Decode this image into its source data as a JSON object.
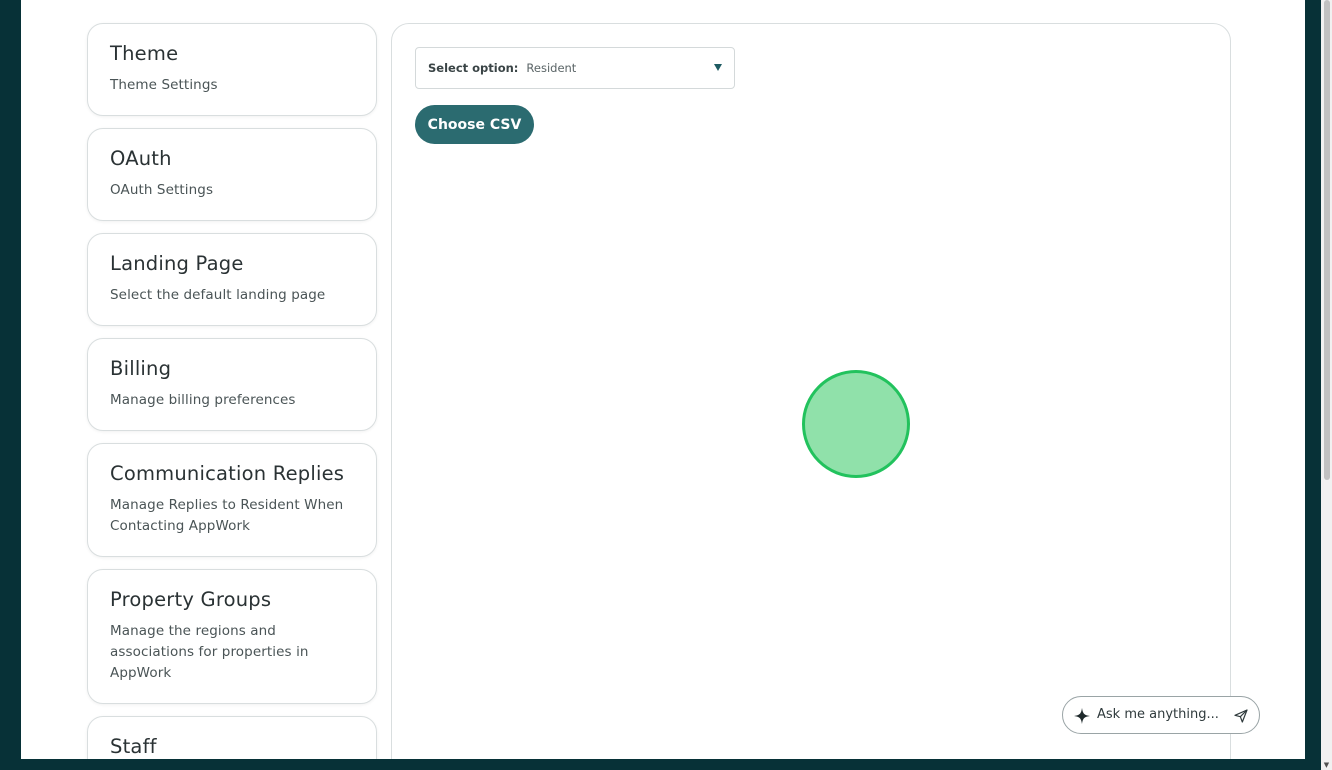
{
  "settings_cards": [
    {
      "title": "Theme",
      "description": "Theme Settings"
    },
    {
      "title": "OAuth",
      "description": "OAuth Settings"
    },
    {
      "title": "Landing Page",
      "description": "Select the default landing page"
    },
    {
      "title": "Billing",
      "description": "Manage billing preferences"
    },
    {
      "title": "Communication Replies",
      "description": "Manage Replies to Resident When Contacting AppWork"
    },
    {
      "title": "Property Groups",
      "description": "Manage the regions and associations for properties in AppWork"
    },
    {
      "title": "Staff",
      "description": ""
    }
  ],
  "import_panel": {
    "select_label": "Select option:",
    "select_value": "Resident",
    "choose_csv_label": "Choose CSV"
  },
  "assistant": {
    "placeholder": "Ask me anything..."
  },
  "colors": {
    "page_background": "#073137",
    "primary_button": "#2b6b70",
    "cursor_fill": "#90e1aa",
    "cursor_border": "#22c25d"
  },
  "icons": [
    "sparkle-icon",
    "send-icon",
    "chevron-down-icon"
  ]
}
